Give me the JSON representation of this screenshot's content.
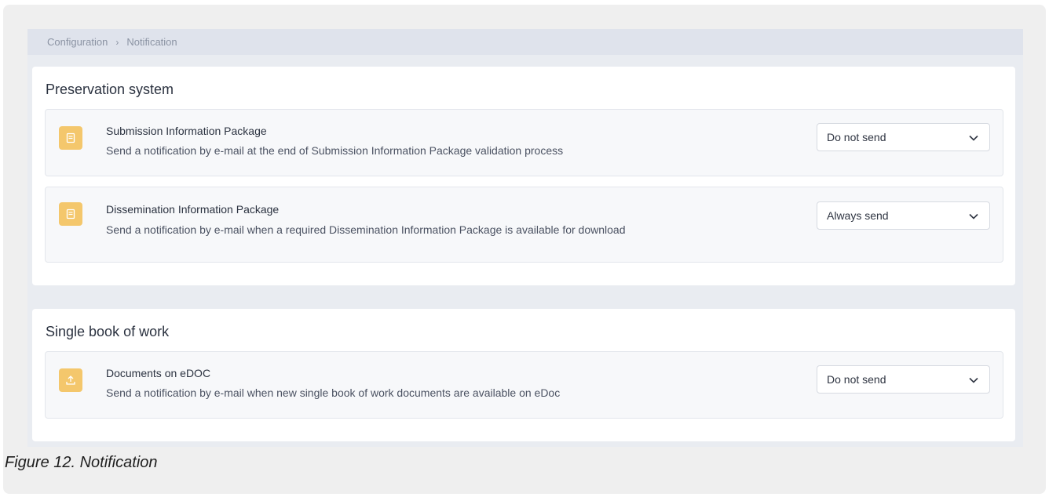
{
  "breadcrumb": [
    "Configuration",
    "Notification"
  ],
  "sections": [
    {
      "title": "Preservation system",
      "items": [
        {
          "icon": "document-icon",
          "title": "Submission Information Package",
          "description": "Send a notification by e-mail at the end of Submission Information Package validation process",
          "select_value": "Do not send"
        },
        {
          "icon": "document-icon",
          "title": "Dissemination Information Package",
          "description": "Send a notification by e-mail when a required Dissemination Information Package is available for download",
          "select_value": "Always send"
        }
      ]
    },
    {
      "title": "Single book of work",
      "items": [
        {
          "icon": "upload-icon",
          "title": "Documents on eDOC",
          "description": "Send a notification by e-mail when new single book of work documents are available on eDoc",
          "select_value": "Do not send"
        }
      ]
    }
  ],
  "caption": "Figure 12. Notification",
  "colors": {
    "icon_bg": "#f4c76c",
    "breadcrumb_bg": "#dfe3ec",
    "content_bg": "#e9ecf1"
  }
}
